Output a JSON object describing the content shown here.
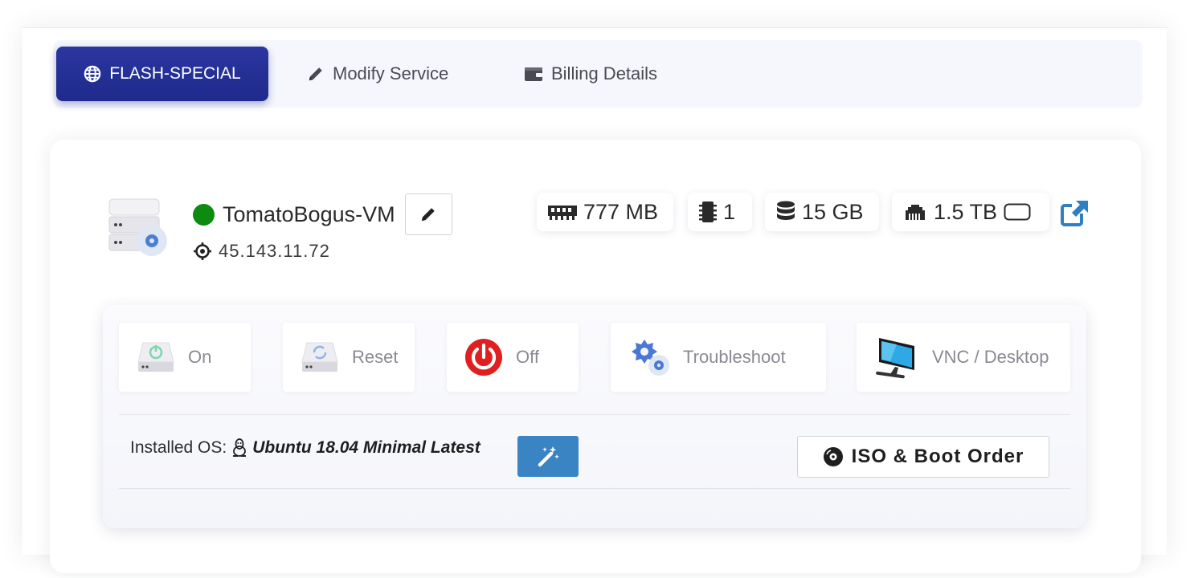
{
  "tabs": [
    {
      "label": "FLASH-SPECIAL",
      "icon": "globe-icon",
      "active": true
    },
    {
      "label": "Modify Service",
      "icon": "pencil-icon",
      "active": false
    },
    {
      "label": "Billing Details",
      "icon": "wallet-icon",
      "active": false
    }
  ],
  "server": {
    "name": "TomatoBogus-VM",
    "status_color": "#0e8a10",
    "ip": "45.143.11.72"
  },
  "specs": {
    "ram": "777 MB",
    "cpu": "1",
    "disk": "15 GB",
    "bandwidth": "1.5 TB"
  },
  "actions": {
    "on": "On",
    "reset": "Reset",
    "off": "Off",
    "troubleshoot": "Troubleshoot",
    "vnc": "VNC / Desktop"
  },
  "os": {
    "label": "Installed OS:",
    "name": "Ubuntu 18.04 Minimal Latest"
  },
  "iso_button": "ISO & Boot Order",
  "colors": {
    "active_tab": "#1f2a8c",
    "status_online": "#0e8a10",
    "power_off": "#e02020",
    "wand_button": "#3b84c4",
    "external_link": "#2f7fc1"
  }
}
